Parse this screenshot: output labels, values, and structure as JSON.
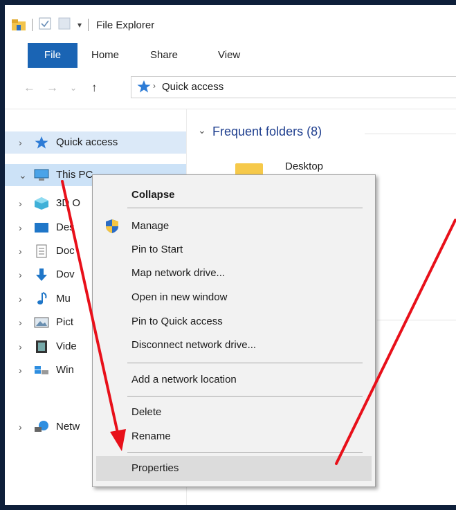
{
  "window": {
    "title": "File Explorer"
  },
  "ribbon": {
    "tabs": [
      "File",
      "Home",
      "Share",
      "View"
    ]
  },
  "address": {
    "path": "Quick access"
  },
  "nav_pane": {
    "items": [
      {
        "label": "Quick access",
        "icon": "star-icon"
      },
      {
        "label": "This PC",
        "icon": "computer-icon"
      },
      {
        "label": "3D O",
        "icon": "cube-icon"
      },
      {
        "label": "Des",
        "icon": "desktop-icon"
      },
      {
        "label": "Doc",
        "icon": "document-icon"
      },
      {
        "label": "Dov",
        "icon": "download-icon"
      },
      {
        "label": "Mu",
        "icon": "music-icon"
      },
      {
        "label": "Pict",
        "icon": "picture-icon"
      },
      {
        "label": "Vide",
        "icon": "video-icon"
      },
      {
        "label": "Win",
        "icon": "drive-icon"
      },
      {
        "label": "Netw",
        "icon": "network-icon"
      }
    ]
  },
  "content": {
    "section_title": "Frequent folders (8)",
    "folder": "Desktop"
  },
  "context_menu": {
    "items": [
      "Collapse",
      "Manage",
      "Pin to Start",
      "Map network drive...",
      "Open in new window",
      "Pin to Quick access",
      "Disconnect network drive...",
      "Add a network location",
      "Delete",
      "Rename",
      "Properties"
    ]
  },
  "colors": {
    "accent": "#1a64b4",
    "annotation": "#e8101a",
    "menu_bg": "#f2f2f2"
  }
}
